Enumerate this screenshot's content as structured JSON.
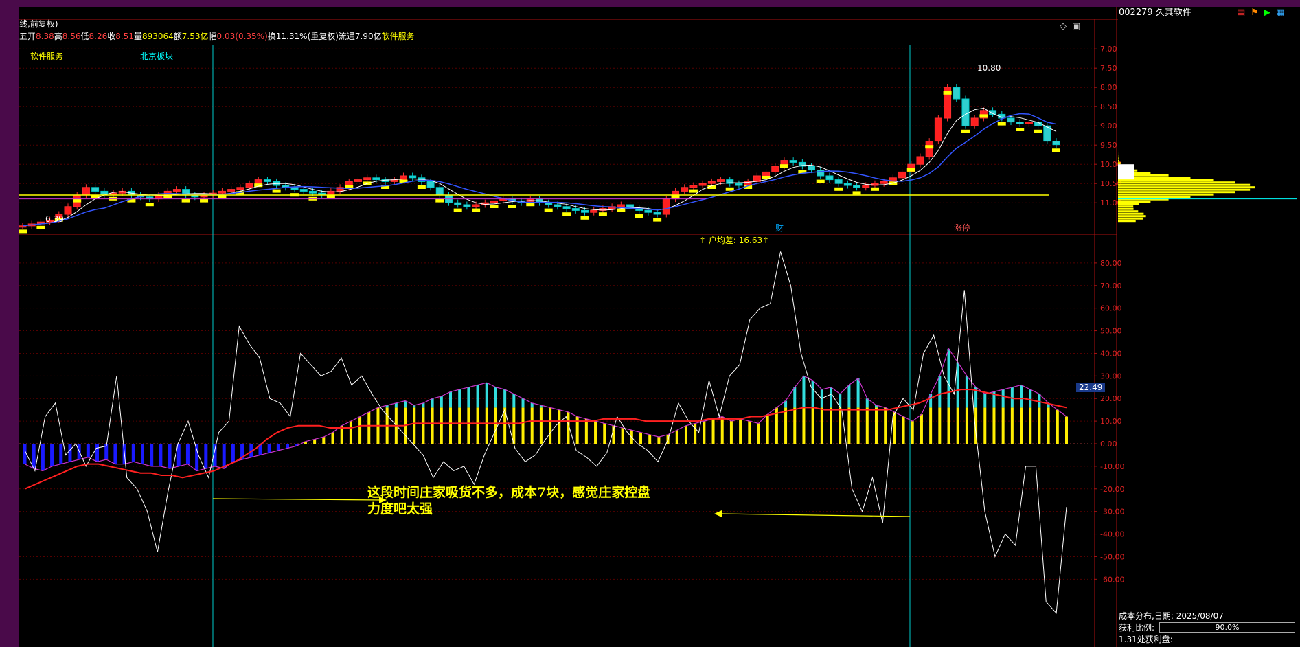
{
  "header": {
    "adjust_mode": "线,前复权)",
    "quote": [
      {
        "label": "开",
        "value": "8.38",
        "color": "#ff4040"
      },
      {
        "label": "高",
        "value": "8.56",
        "color": "#ff4040"
      },
      {
        "label": "低",
        "value": "8.26",
        "color": "#ff4040"
      },
      {
        "label": "收",
        "value": "8.51",
        "color": "#ff4040"
      },
      {
        "label": "量",
        "value": "893064",
        "color": "#ffff00"
      },
      {
        "label": "额",
        "value": "7.53亿",
        "color": "#ffff00"
      },
      {
        "label": "幅",
        "value": "0.03(0.35%)",
        "color": "#ff4040"
      },
      {
        "label": "换",
        "value": "11.31%(重复权)",
        "color": "#ffffff"
      },
      {
        "label": "流通",
        "value": "7.90亿",
        "color": "#ffffff"
      }
    ],
    "sector": "软件服务",
    "row1_prefix": "五"
  },
  "main_chart": {
    "tags": [
      "软件服务",
      "北京板块"
    ],
    "max_label": "10.80",
    "min_label": "6.39",
    "event_labels": [
      "财",
      "涨停"
    ],
    "price_ticks": [
      "11.00",
      "10.50",
      "10.00",
      "9.50",
      "9.00",
      "8.50",
      "8.00",
      "7.50",
      "7.00"
    ]
  },
  "indicator": {
    "title": "户均差: 16.63",
    "current_value": "22.49",
    "ticks": [
      "80.00",
      "70.00",
      "60.00",
      "50.00",
      "40.00",
      "30.00",
      "20.00",
      "10.00",
      "0.00",
      "-10.00",
      "-20.00",
      "-30.00",
      "-40.00",
      "-50.00",
      "-60.00"
    ]
  },
  "annotation": {
    "line1": "这段时间庄家吸货不多，成本7块，感觉庄家控盘",
    "line2": "力度吧太强"
  },
  "side_panel": {
    "stock": "002279 久其软件",
    "dist_title": "成本分布,日期:",
    "dist_date": "2025/08/07",
    "profit_label": "获利比例:",
    "profit_value": "90.0%",
    "profit_pct": 90,
    "profit_at": "1.31处获利盘:"
  },
  "chart_data": [
    {
      "type": "candlestick",
      "title": "",
      "ylim": [
        6.2,
        11.2
      ],
      "y_ticks": [
        7.0,
        7.5,
        8.0,
        8.5,
        9.0,
        9.5,
        10.0,
        10.5,
        11.0
      ],
      "close_series": [
        6.4,
        6.45,
        6.5,
        6.55,
        6.7,
        6.9,
        7.2,
        7.4,
        7.3,
        7.2,
        7.25,
        7.3,
        7.2,
        7.15,
        7.1,
        7.2,
        7.3,
        7.35,
        7.2,
        7.15,
        7.2,
        7.25,
        7.3,
        7.35,
        7.4,
        7.5,
        7.6,
        7.55,
        7.45,
        7.4,
        7.35,
        7.3,
        7.25,
        7.2,
        7.3,
        7.4,
        7.55,
        7.6,
        7.65,
        7.6,
        7.55,
        7.6,
        7.7,
        7.65,
        7.55,
        7.4,
        7.2,
        7.0,
        6.95,
        6.9,
        6.95,
        7.0,
        7.05,
        7.1,
        7.05,
        7.0,
        7.1,
        7.0,
        6.95,
        6.9,
        6.85,
        6.8,
        6.75,
        6.8,
        6.85,
        6.9,
        6.95,
        6.85,
        6.8,
        6.75,
        6.7,
        7.1,
        7.3,
        7.4,
        7.45,
        7.5,
        7.55,
        7.6,
        7.5,
        7.45,
        7.55,
        7.7,
        7.8,
        7.95,
        8.1,
        8.05,
        7.95,
        7.85,
        7.7,
        7.6,
        7.5,
        7.45,
        7.4,
        7.45,
        7.5,
        7.55,
        7.65,
        7.8,
        8.0,
        8.2,
        8.6,
        9.2,
        10.0,
        9.7,
        9.0,
        9.2,
        9.4,
        9.3,
        9.2,
        9.1,
        9.05,
        9.1,
        9.0,
        8.6,
        8.51
      ],
      "events": [
        {
          "label": "财",
          "at_index": 91
        },
        {
          "label": "涨停",
          "at_index": 102
        }
      ],
      "max": 10.8,
      "min": 6.39
    },
    {
      "type": "bar",
      "title": "户均差",
      "latest": 16.63,
      "ylim": [
        -90,
        90
      ],
      "y_ticks": [
        -60,
        -50,
        -40,
        -30,
        -20,
        -10,
        0,
        10,
        20,
        30,
        40,
        50,
        60,
        70,
        80
      ],
      "series": [
        {
          "values": [
            -9,
            -11,
            -12,
            -10,
            -9,
            -8,
            -7,
            -6,
            -8,
            -7,
            -9,
            -9,
            -8,
            -9,
            -10,
            -10,
            -11,
            -10,
            -9,
            -12,
            -11,
            -10,
            -11,
            -8,
            -7,
            -6,
            -5,
            -4,
            -3,
            -2,
            -1,
            1,
            2,
            3,
            5,
            8,
            10,
            12,
            14,
            16,
            17,
            18,
            19,
            17,
            18,
            20,
            21,
            23,
            24,
            25,
            26,
            27,
            25,
            24,
            22,
            20,
            18,
            17,
            16,
            15,
            14,
            12,
            11,
            10,
            9,
            8,
            7,
            6,
            5,
            4,
            3,
            4,
            6,
            8,
            9,
            10,
            11,
            12,
            10,
            11,
            10,
            9,
            13,
            16,
            19,
            25,
            30,
            28,
            24,
            25,
            22,
            26,
            29,
            20,
            17,
            16,
            14,
            12,
            10,
            13,
            22,
            30,
            42,
            36,
            30,
            25,
            22,
            23,
            24,
            25,
            26,
            24,
            22,
            18,
            15,
            12
          ]
        },
        {
          "values": [
            -3,
            -12,
            12,
            18,
            -5,
            0,
            -10,
            -2,
            -1,
            30,
            -15,
            -20,
            -30,
            -48,
            -22,
            0,
            10,
            -5,
            -15,
            5,
            10,
            52,
            44,
            38,
            20,
            18,
            12,
            40,
            35,
            30,
            32,
            38,
            26,
            30,
            22,
            15,
            10,
            5,
            0,
            -5,
            -15,
            -8,
            -12,
            -10,
            -18,
            -5,
            5,
            15,
            -2,
            -8,
            -5,
            2,
            8,
            12,
            -3,
            -6,
            -10,
            -4,
            12,
            5,
            0,
            -3,
            -8,
            2,
            18,
            10,
            5,
            28,
            12,
            30,
            35,
            55,
            60,
            62,
            85,
            70,
            40,
            25,
            20,
            22,
            15,
            -20,
            -30,
            -15,
            -35,
            12,
            20,
            15,
            40,
            48,
            30,
            22,
            68,
            10,
            -30,
            -50,
            -40,
            -45,
            -10,
            -10,
            -70,
            -75,
            -28
          ]
        },
        {
          "values": [
            -20,
            -18,
            -16,
            -14,
            -12,
            -10,
            -9,
            -9,
            -10,
            -11,
            -12,
            -13,
            -13,
            -14,
            -14,
            -15,
            -14,
            -13,
            -12,
            -10,
            -8,
            -5,
            -2,
            2,
            5,
            7,
            8,
            8,
            8,
            7,
            7,
            7,
            8,
            8,
            8,
            8,
            8,
            9,
            9,
            9,
            9,
            9,
            9,
            9,
            9,
            9,
            9,
            9,
            10,
            10,
            10,
            10,
            10,
            10,
            10,
            11,
            11,
            11,
            11,
            10,
            10,
            10,
            10,
            10,
            10,
            11,
            11,
            11,
            11,
            12,
            12,
            13,
            14,
            15,
            16,
            16,
            15,
            15,
            15,
            15,
            15,
            15,
            15,
            16,
            17,
            18,
            20,
            22,
            23,
            24,
            24,
            23,
            22,
            21,
            20,
            20,
            19,
            18,
            17,
            16
          ]
        }
      ]
    }
  ]
}
